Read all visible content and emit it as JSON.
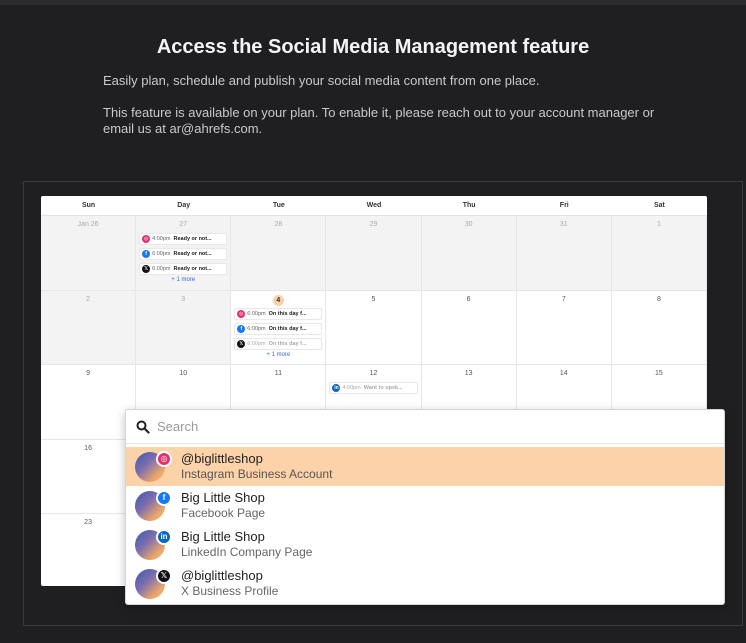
{
  "header": {
    "title": "Access the Social Media Management feature",
    "subtitle": "Easily plan, schedule and publish your social media content from one place.",
    "availability": "This feature is available on your plan. To enable it, please reach out to your account manager or email us at ar@ahrefs.com."
  },
  "calendar": {
    "weekdays": [
      "Sun",
      "Day",
      "Tue",
      "Wed",
      "Thu",
      "Fri",
      "Sat"
    ],
    "rows": [
      [
        {
          "day": "Jan 26",
          "gray": true
        },
        {
          "day": "27",
          "gray": true,
          "events": [
            {
              "net": "ig",
              "icon": "instagram-icon",
              "time": "4:00pm",
              "text": "Ready or not..."
            },
            {
              "net": "fb",
              "icon": "facebook-icon",
              "time": "6:00pm",
              "text": "Ready or not..."
            },
            {
              "net": "x",
              "icon": "x-icon",
              "time": "6:00pm",
              "text": "Ready or not..."
            }
          ],
          "more": "+ 1 more"
        },
        {
          "day": "28",
          "gray": true
        },
        {
          "day": "29",
          "gray": true
        },
        {
          "day": "30",
          "gray": true
        },
        {
          "day": "31",
          "gray": true
        },
        {
          "day": "1",
          "gray": true
        }
      ],
      [
        {
          "day": "2",
          "gray": true
        },
        {
          "day": "3",
          "gray": true
        },
        {
          "day": "4",
          "today": true,
          "events": [
            {
              "net": "ig",
              "icon": "instagram-icon",
              "time": "6:00pm",
              "text": "On this day f..."
            },
            {
              "net": "fb",
              "icon": "facebook-icon",
              "time": "6:00pm",
              "text": "On this day f..."
            },
            {
              "net": "x",
              "icon": "x-icon",
              "time": "6:00pm",
              "text": "On this day f...",
              "faded": true
            }
          ],
          "more": "+ 1 more"
        },
        {
          "day": "5"
        },
        {
          "day": "6"
        },
        {
          "day": "7"
        },
        {
          "day": "8"
        }
      ],
      [
        {
          "day": "9"
        },
        {
          "day": "10"
        },
        {
          "day": "11"
        },
        {
          "day": "12",
          "events": [
            {
              "net": "li",
              "icon": "linkedin-icon",
              "time": "4:00pm",
              "text": "Want to upsk...",
              "faded": true
            }
          ]
        },
        {
          "day": "13"
        },
        {
          "day": "14"
        },
        {
          "day": "15"
        }
      ],
      [
        {
          "day": "16"
        },
        {
          "day": ""
        },
        {
          "day": ""
        },
        {
          "day": ""
        },
        {
          "day": ""
        },
        {
          "day": ""
        },
        {
          "day": ""
        }
      ],
      [
        {
          "day": "23"
        },
        {
          "day": ""
        },
        {
          "day": ""
        },
        {
          "day": ""
        },
        {
          "day": ""
        },
        {
          "day": ""
        },
        {
          "day": ""
        }
      ]
    ]
  },
  "account_picker": {
    "search_placeholder": "Search",
    "accounts": [
      {
        "name": "@biglittleshop",
        "type": "Instagram Business Account",
        "net": "ig",
        "icon": "instagram-icon",
        "selected": true
      },
      {
        "name": "Big Little Shop",
        "type": "Facebook Page",
        "net": "fb",
        "icon": "facebook-icon"
      },
      {
        "name": "Big Little Shop",
        "type": "LinkedIn Company Page",
        "net": "li",
        "icon": "linkedin-icon"
      },
      {
        "name": "@biglittleshop",
        "type": "X Business Profile",
        "net": "x",
        "icon": "x-icon"
      }
    ]
  }
}
